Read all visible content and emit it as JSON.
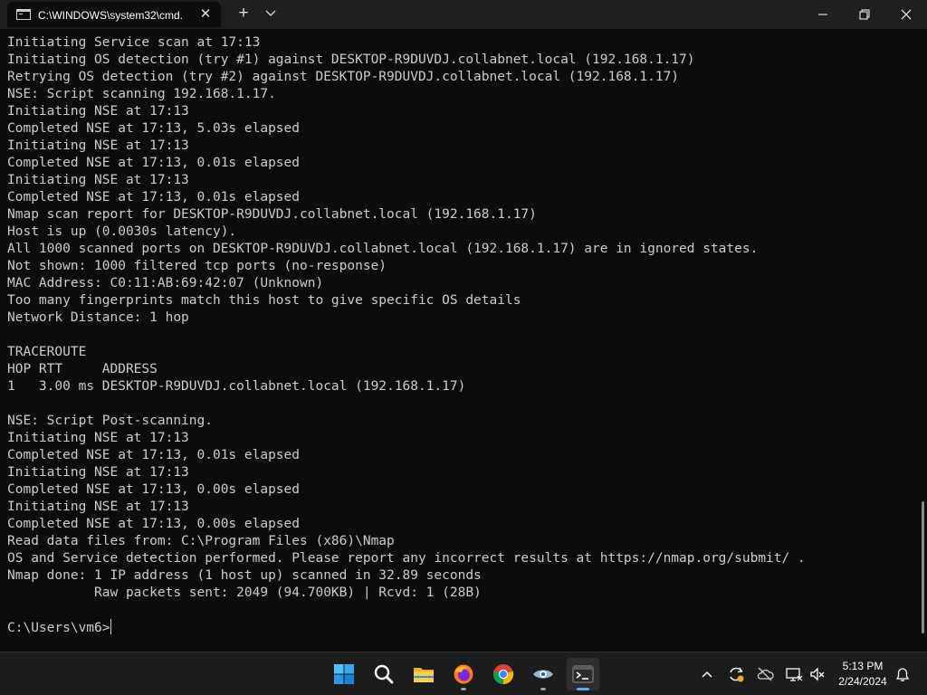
{
  "window": {
    "tab_title": "C:\\WINDOWS\\system32\\cmd.",
    "tab_close": "✕",
    "new_tab": "+"
  },
  "terminal": {
    "lines": [
      "Initiating Service scan at 17:13",
      "Initiating OS detection (try #1) against DESKTOP-R9DUVDJ.collabnet.local (192.168.1.17)",
      "Retrying OS detection (try #2) against DESKTOP-R9DUVDJ.collabnet.local (192.168.1.17)",
      "NSE: Script scanning 192.168.1.17.",
      "Initiating NSE at 17:13",
      "Completed NSE at 17:13, 5.03s elapsed",
      "Initiating NSE at 17:13",
      "Completed NSE at 17:13, 0.01s elapsed",
      "Initiating NSE at 17:13",
      "Completed NSE at 17:13, 0.01s elapsed",
      "Nmap scan report for DESKTOP-R9DUVDJ.collabnet.local (192.168.1.17)",
      "Host is up (0.0030s latency).",
      "All 1000 scanned ports on DESKTOP-R9DUVDJ.collabnet.local (192.168.1.17) are in ignored states.",
      "Not shown: 1000 filtered tcp ports (no-response)",
      "MAC Address: C0:11:AB:69:42:07 (Unknown)",
      "Too many fingerprints match this host to give specific OS details",
      "Network Distance: 1 hop",
      "",
      "TRACEROUTE",
      "HOP RTT     ADDRESS",
      "1   3.00 ms DESKTOP-R9DUVDJ.collabnet.local (192.168.1.17)",
      "",
      "NSE: Script Post-scanning.",
      "Initiating NSE at 17:13",
      "Completed NSE at 17:13, 0.01s elapsed",
      "Initiating NSE at 17:13",
      "Completed NSE at 17:13, 0.00s elapsed",
      "Initiating NSE at 17:13",
      "Completed NSE at 17:13, 0.00s elapsed",
      "Read data files from: C:\\Program Files (x86)\\Nmap",
      "OS and Service detection performed. Please report any incorrect results at https://nmap.org/submit/ .",
      "Nmap done: 1 IP address (1 host up) scanned in 32.89 seconds",
      "           Raw packets sent: 2049 (94.700KB) | Rcvd: 1 (28B)",
      "",
      "C:\\Users\\vm6>"
    ]
  },
  "taskbar": {
    "icons": [
      "windows-start-icon",
      "search-icon",
      "file-explorer-icon",
      "firefox-icon",
      "chrome-icon",
      "eye-app-icon",
      "terminal-icon"
    ],
    "tray_icons": [
      "chevron-up-icon",
      "sync-icon",
      "cloud-icon",
      "network-icon",
      "volume-muted-icon",
      "notification-bell-icon"
    ]
  },
  "clock": {
    "time": "5:13 PM",
    "date": "2/24/2024"
  },
  "colors": {
    "terminal_bg": "#0c0c0c",
    "terminal_fg": "#cccccc",
    "titlebar_bg": "#1f1f1f",
    "taskbar_bg": "#1c1c1c",
    "accent": "#56a8ff"
  }
}
